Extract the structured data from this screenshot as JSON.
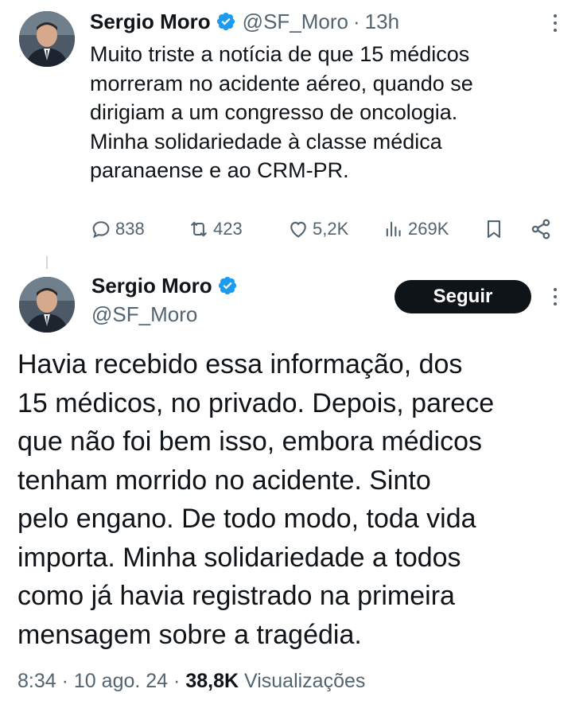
{
  "tweet1": {
    "author_name": "Sergio Moro",
    "handle": "@SF_Moro",
    "separator": "·",
    "time": "13h",
    "text": "Muito triste a notícia de que 15 médicos\nmorreram no acidente aéreo, quando se\ndirigiam a um congresso de oncologia.\nMinha solidariedade à classe médica\nparanaense e ao CRM-PR.",
    "actions": {
      "replies": "838",
      "retweets": "423",
      "likes": "5,2K",
      "views": "269K"
    },
    "icons": [
      "reply-icon",
      "retweet-icon",
      "like-icon",
      "views-icon",
      "bookmark-icon",
      "share-icon",
      "more-icon",
      "verified-icon"
    ]
  },
  "tweet2": {
    "author_name": "Sergio Moro",
    "handle": "@SF_Moro",
    "follow_label": "Seguir",
    "text": "Havia recebido essa informação, dos\n15 médicos, no privado. Depois, parece\nque não foi bem isso, embora médicos\ntenham morrido no acidente. Sinto\npelo engano. De todo modo, toda vida\nimporta. Minha solidariedade a todos\ncomo já havia registrado na primeira\nmensagem sobre a tragédia.",
    "time": "8:34",
    "separator": "·",
    "date": "10 ago. 24",
    "views_count": "38,8K",
    "views_label": "Visualizações"
  },
  "colors": {
    "text_primary": "#0f1419",
    "text_secondary": "#536471",
    "verified_blue": "#1d9bf0",
    "follow_button_bg": "#0f1419"
  }
}
